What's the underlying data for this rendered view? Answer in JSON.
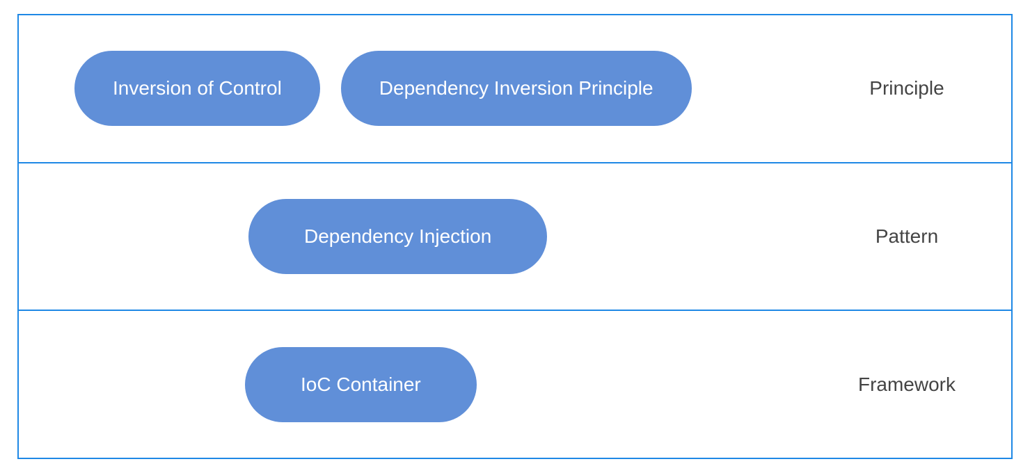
{
  "rows": [
    {
      "label": "Principle",
      "pills": [
        {
          "text": "Inversion of Control",
          "offset_class": "pill-offset-1"
        },
        {
          "text": "Dependency Inversion Principle",
          "offset_class": ""
        }
      ]
    },
    {
      "label": "Pattern",
      "pills": [
        {
          "text": "Dependency Injection",
          "offset_class": "pill-offset-2 pill-wide"
        }
      ]
    },
    {
      "label": "Framework",
      "pills": [
        {
          "text": "IoC Container",
          "offset_class": "pill-offset-3 pill-wide"
        }
      ]
    }
  ]
}
